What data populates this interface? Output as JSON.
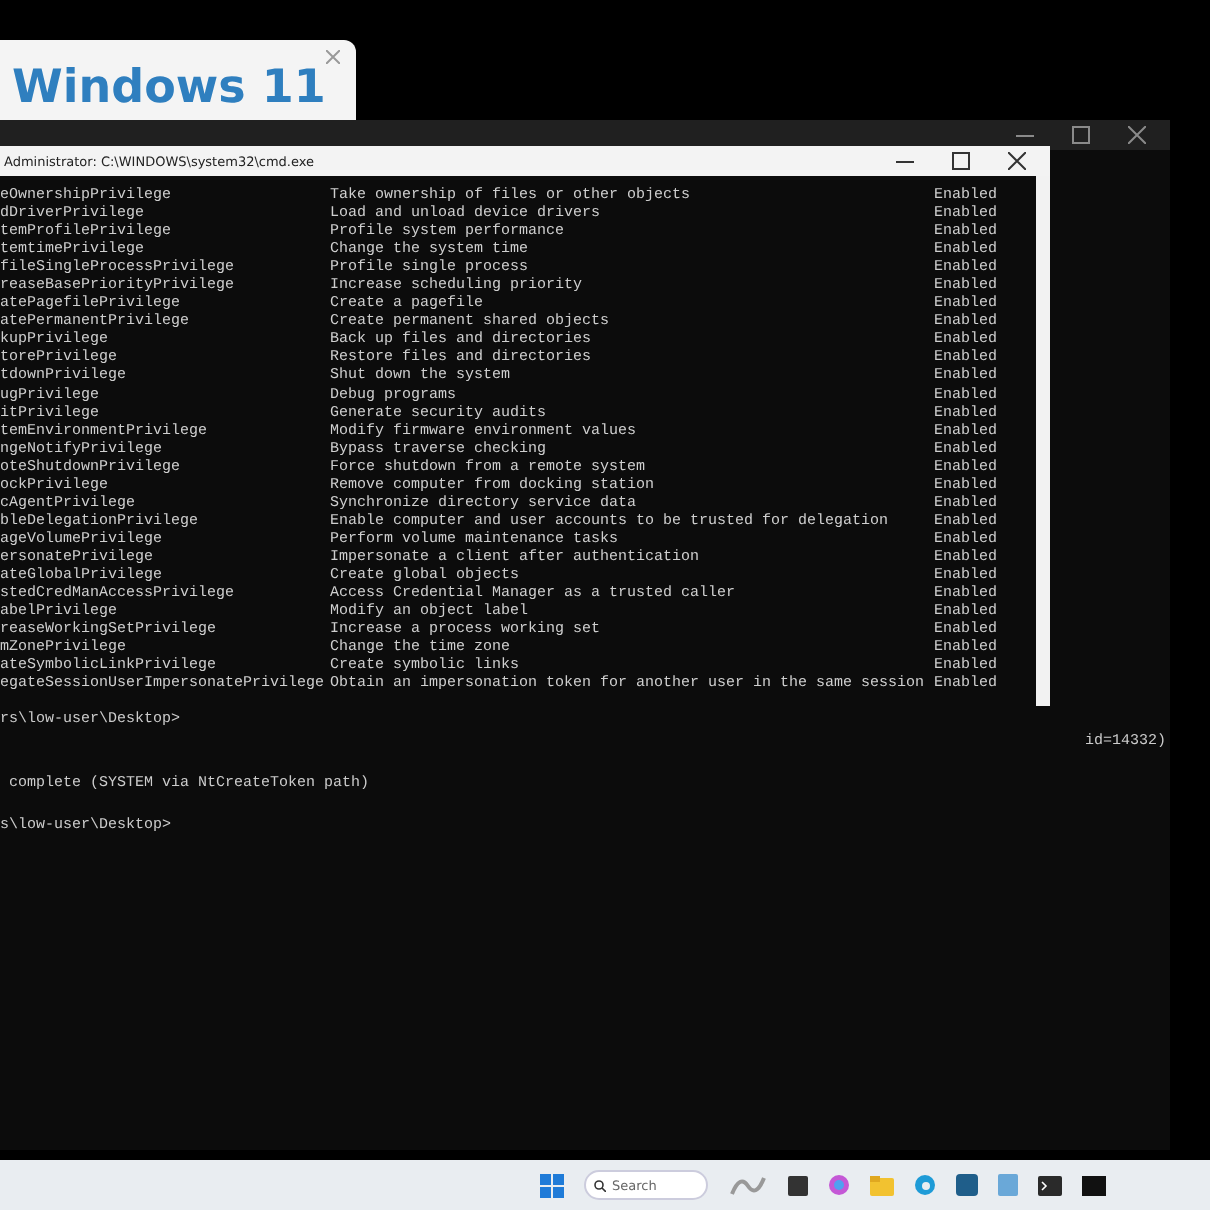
{
  "dialog": {
    "title": "Windows 11"
  },
  "back_window": {
    "lines": [
      {
        "kind": "left",
        "text": "rs\\low-user\\Desktop>"
      },
      {
        "kind": "right",
        "text": "id=14332)"
      },
      {
        "kind": "left",
        "text": " complete (SYSTEM via NtCreateToken path)"
      },
      {
        "kind": "left",
        "text": "s\\low-user\\Desktop>"
      }
    ]
  },
  "front_window": {
    "title": "Administrator: C:\\WINDOWS\\system32\\cmd.exe",
    "rows": [
      {
        "name": "eOwnershipPrivilege",
        "description": "Take ownership of files or other objects",
        "state": "Enabled"
      },
      {
        "name": "dDriverPrivilege",
        "description": "Load and unload device drivers",
        "state": "Enabled"
      },
      {
        "name": "temProfilePrivilege",
        "description": "Profile system performance",
        "state": "Enabled"
      },
      {
        "name": "temtimePrivilege",
        "description": "Change the system time",
        "state": "Enabled"
      },
      {
        "name": "fileSingleProcessPrivilege",
        "description": "Profile single process",
        "state": "Enabled"
      },
      {
        "name": "reaseBasePriorityPrivilege",
        "description": "Increase scheduling priority",
        "state": "Enabled"
      },
      {
        "name": "atePagefilePrivilege",
        "description": "Create a pagefile",
        "state": "Enabled"
      },
      {
        "name": "atePermanentPrivilege",
        "description": "Create permanent shared objects",
        "state": "Enabled"
      },
      {
        "name": "kupPrivilege",
        "description": "Back up files and directories",
        "state": "Enabled"
      },
      {
        "name": "torePrivilege",
        "description": "Restore files and directories",
        "state": "Enabled"
      },
      {
        "name": "tdownPrivilege",
        "description": "Shut down the system",
        "state": "Enabled"
      },
      {
        "name": "ugPrivilege",
        "description": "Debug programs",
        "state": "Enabled"
      },
      {
        "name": "itPrivilege",
        "description": "Generate security audits",
        "state": "Enabled"
      },
      {
        "name": "temEnvironmentPrivilege",
        "description": "Modify firmware environment values",
        "state": "Enabled"
      },
      {
        "name": "ngeNotifyPrivilege",
        "description": "Bypass traverse checking",
        "state": "Enabled"
      },
      {
        "name": "oteShutdownPrivilege",
        "description": "Force shutdown from a remote system",
        "state": "Enabled"
      },
      {
        "name": "ockPrivilege",
        "description": "Remove computer from docking station",
        "state": "Enabled"
      },
      {
        "name": "cAgentPrivilege",
        "description": "Synchronize directory service data",
        "state": "Enabled"
      },
      {
        "name": "bleDelegationPrivilege",
        "description": "Enable computer and user accounts to be trusted for delegation",
        "state": "Enabled"
      },
      {
        "name": "ageVolumePrivilege",
        "description": "Perform volume maintenance tasks",
        "state": "Enabled"
      },
      {
        "name": "ersonatePrivilege",
        "description": "Impersonate a client after authentication",
        "state": "Enabled"
      },
      {
        "name": "ateGlobalPrivilege",
        "description": "Create global objects",
        "state": "Enabled"
      },
      {
        "name": "stedCredManAccessPrivilege",
        "description": "Access Credential Manager as a trusted caller",
        "state": "Enabled"
      },
      {
        "name": "abelPrivilege",
        "description": "Modify an object label",
        "state": "Enabled"
      },
      {
        "name": "reaseWorkingSetPrivilege",
        "description": "Increase a process working set",
        "state": "Enabled"
      },
      {
        "name": "mZonePrivilege",
        "description": "Change the time zone",
        "state": "Enabled"
      },
      {
        "name": "ateSymbolicLinkPrivilege",
        "description": "Create symbolic links",
        "state": "Enabled"
      },
      {
        "name": "egateSessionUserImpersonatePrivilege",
        "description": "Obtain an impersonation token for another user in the same session",
        "state": "Enabled"
      }
    ]
  },
  "taskbar": {
    "search": {
      "placeholder": "Search"
    }
  }
}
